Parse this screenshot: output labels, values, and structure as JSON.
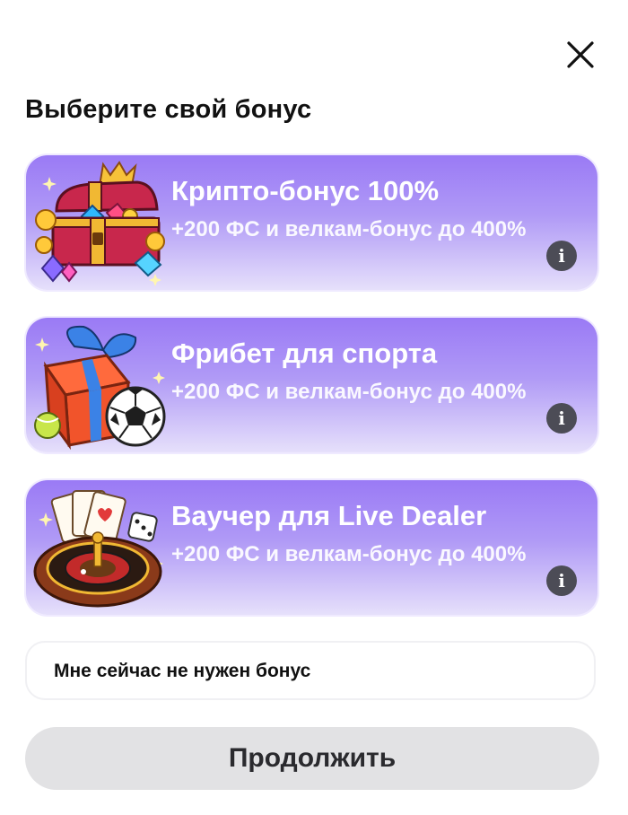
{
  "header": {
    "title": "Выберите свой бонус",
    "close_icon": "close-icon"
  },
  "bonuses": [
    {
      "title": "Крипто-бонус 100%",
      "description": "+200 ФС и велкам-бонус до 400%",
      "illustration": "treasure-chest-icon",
      "info_icon": "info-icon",
      "info_glyph": "i"
    },
    {
      "title": "Фрибет для спорта",
      "description": "+200 ФС и велкам-бонус до 400%",
      "illustration": "gift-sports-icon",
      "info_icon": "info-icon",
      "info_glyph": "i"
    },
    {
      "title": "Ваучер для Live Dealer",
      "description": "+200 ФС и велкам-бонус до 400%",
      "illustration": "roulette-cards-icon",
      "info_icon": "info-icon",
      "info_glyph": "i"
    }
  ],
  "skip_option": {
    "label": "Мне сейчас не нужен бонус"
  },
  "continue_button": {
    "label": "Продолжить"
  },
  "colors": {
    "card_gradient_top": "#9a7af5",
    "card_gradient_bottom": "#e6e0fb",
    "info_button": "#4c4c56",
    "continue_button_bg": "#e2e2e4"
  }
}
